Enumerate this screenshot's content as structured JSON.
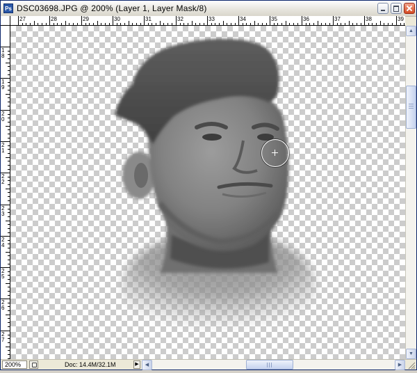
{
  "window": {
    "app_icon": "Ps",
    "title": "DSC03698.JPG @ 200% (Layer 1, Layer Mask/8)"
  },
  "rulers": {
    "horizontal_labels": [
      "27",
      "28",
      "29",
      "30",
      "31",
      "32",
      "33",
      "34",
      "35",
      "36",
      "37",
      "38",
      "39"
    ],
    "vertical_labels": [
      "1",
      "1",
      "2",
      "2",
      "2",
      "2",
      "2",
      "2",
      "2",
      "2",
      "2"
    ],
    "horizontal_sublabels": [
      "",
      "",
      "",
      "",
      "",
      "",
      "",
      "",
      "",
      "",
      "",
      "",
      ""
    ],
    "vertical_sublabels": [
      "8",
      "9",
      "0",
      "1",
      "2",
      "3",
      "4",
      "5",
      "6",
      "7",
      "8"
    ]
  },
  "canvas": {
    "image_subject": "portrait-photo",
    "transparency_color_a": "#cccccc",
    "transparency_color_b": "#ffffff",
    "tool": "brush-cursor"
  },
  "status": {
    "zoom": "200%",
    "doc_info": "Doc: 14.4M/32.1M"
  },
  "icons": {
    "minimize": "minimize-icon",
    "maximize": "maximize-icon",
    "close": "close-icon",
    "scroll_up": "▲",
    "scroll_down": "▼",
    "scroll_left": "◀",
    "scroll_right": "▶",
    "status_menu": "▶"
  }
}
